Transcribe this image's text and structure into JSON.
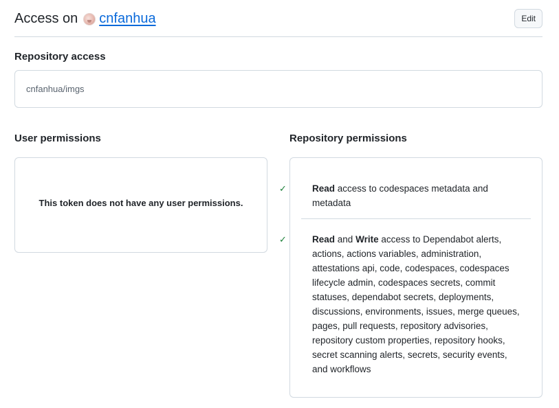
{
  "header": {
    "prefix": "Access on",
    "owner": "cnfanhua",
    "edit_label": "Edit"
  },
  "repository_access": {
    "label": "Repository access",
    "repo": "cnfanhua/imgs"
  },
  "user_permissions": {
    "label": "User permissions",
    "empty_message": "This token does not have any user permissions."
  },
  "repository_permissions": {
    "label": "Repository permissions",
    "items": [
      {
        "level_a": "Read",
        "level_joiner": "",
        "level_b": "",
        "text": "access to codespaces metadata and metadata"
      },
      {
        "level_a": "Read",
        "level_joiner": "and",
        "level_b": "Write",
        "text": "access to Dependabot alerts, actions, actions variables, administration, attestations api, code, codespaces, codespaces lifecycle admin, codespaces secrets, commit statuses, dependabot secrets, deployments, discussions, environments, issues, merge queues, pages, pull requests, repository advisories, repository custom properties, repository hooks, secret scanning alerts, secrets, security events, and workflows"
      }
    ]
  },
  "colors": {
    "link": "#0969da",
    "check": "#1a7f37",
    "border": "#d1d9e0",
    "muted": "#59636e"
  },
  "icons": {
    "owner_avatar": "avatar-icon",
    "permission": "check-icon"
  }
}
